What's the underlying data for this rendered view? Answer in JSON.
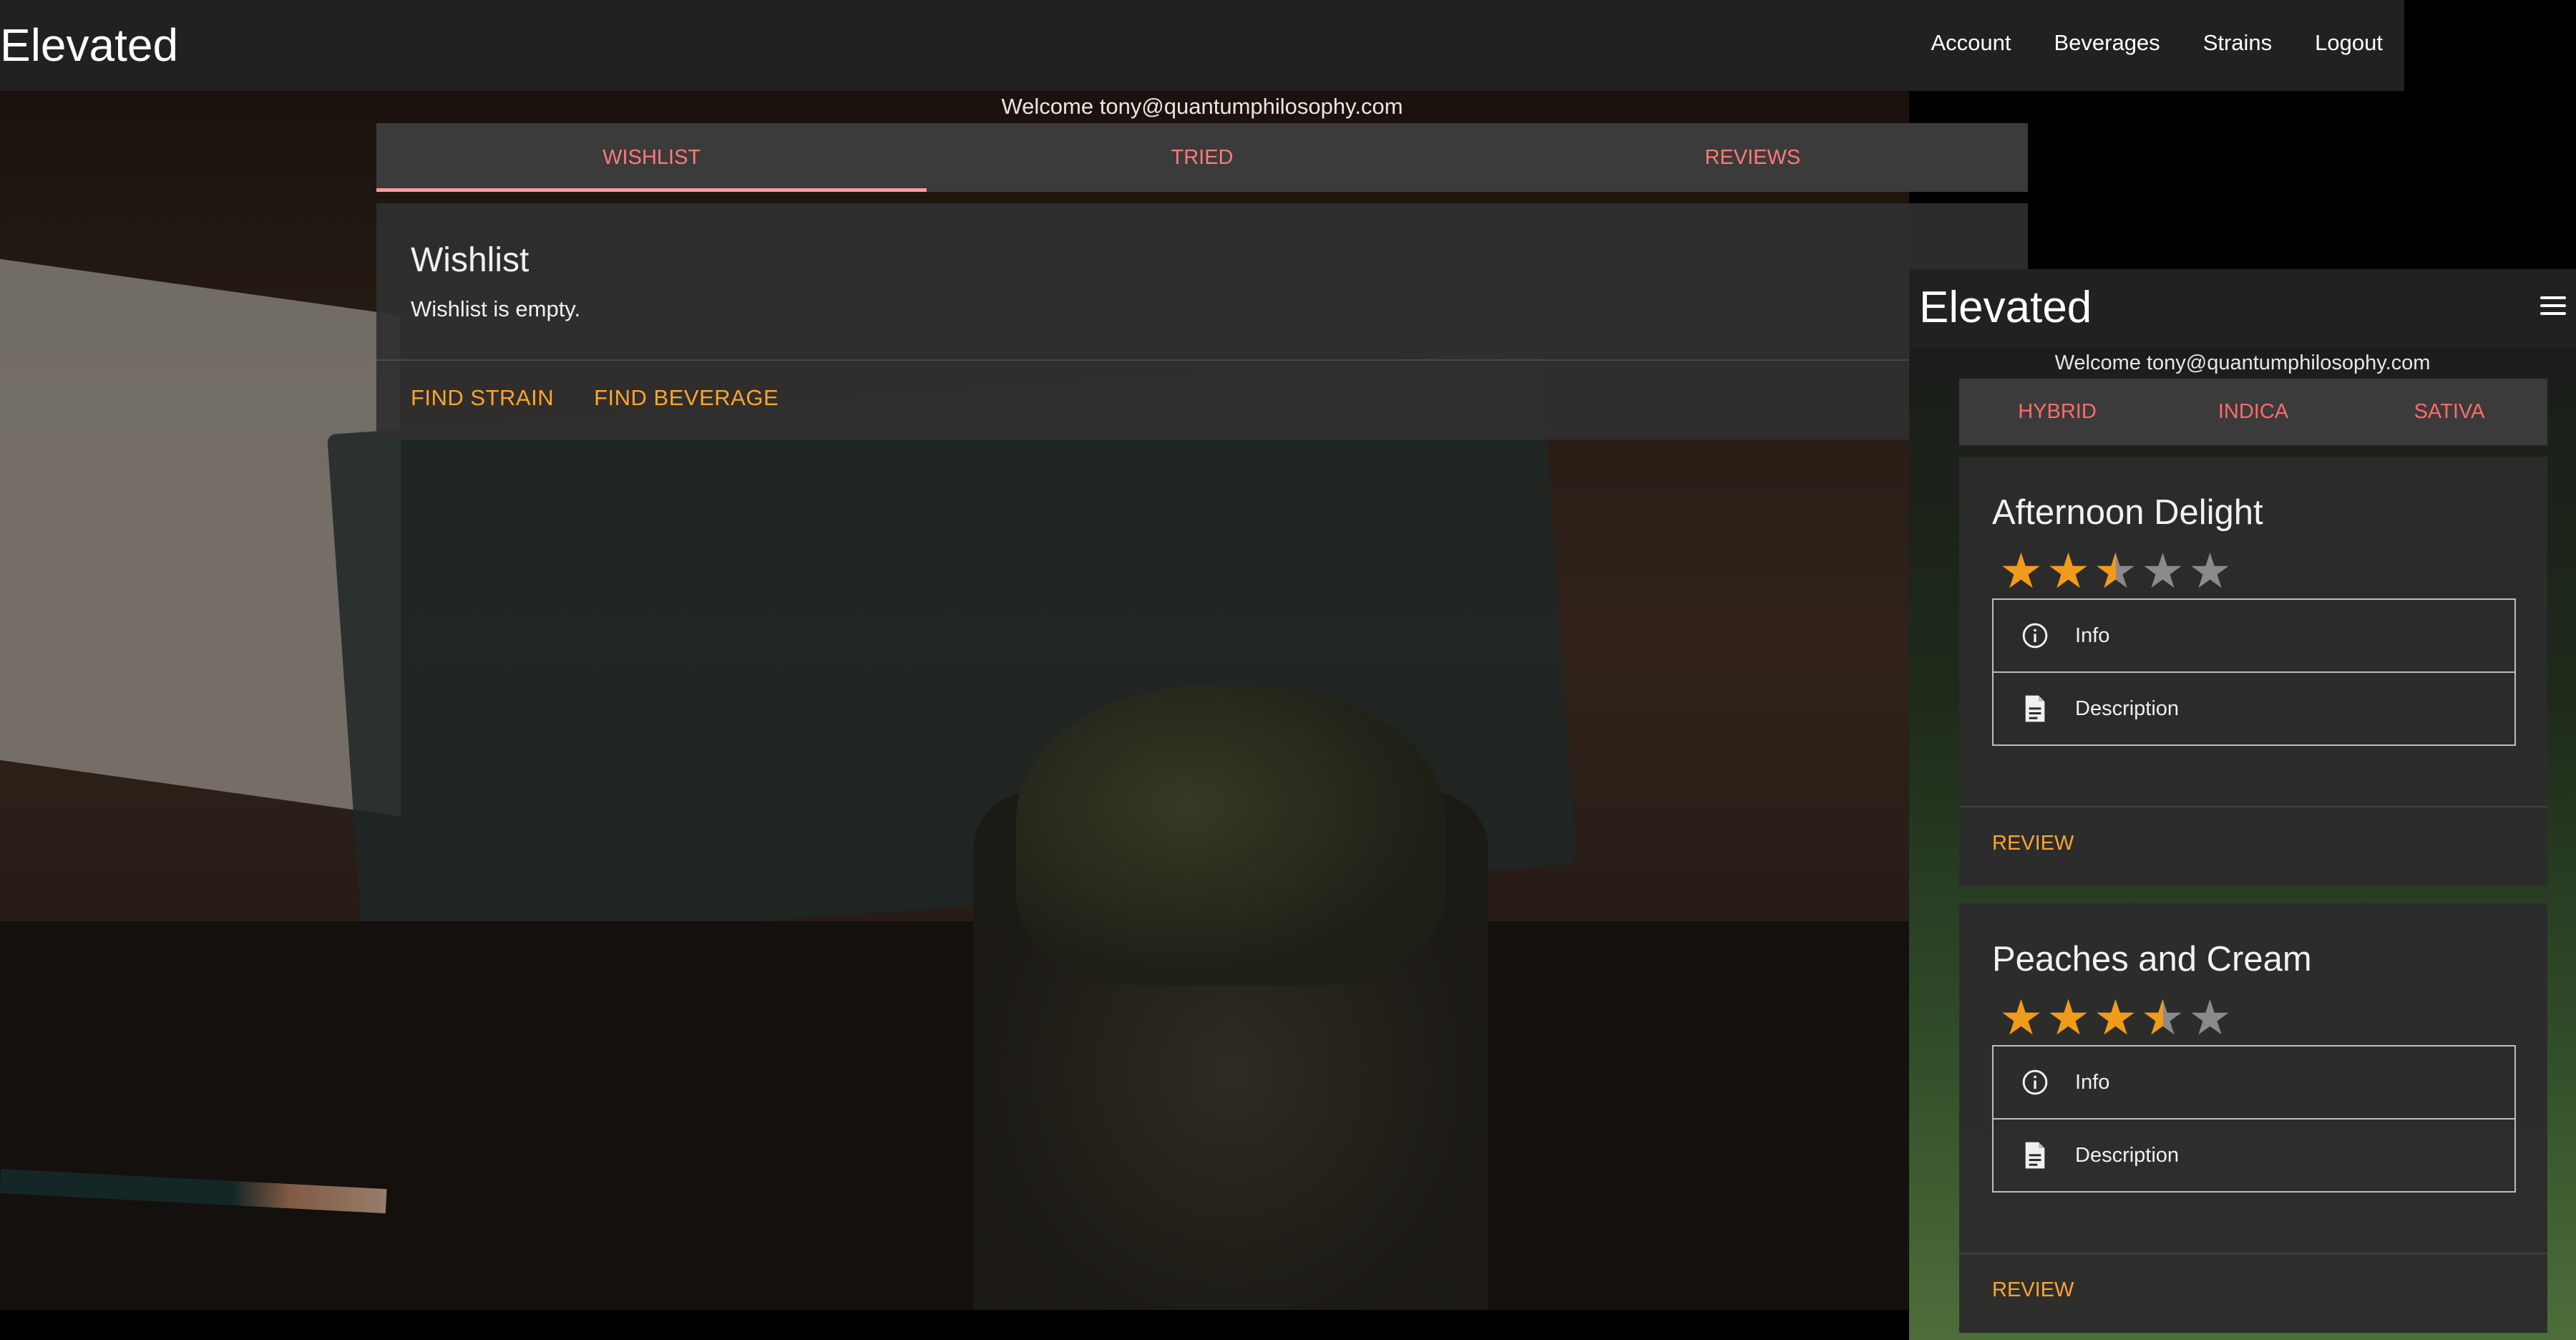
{
  "desktop": {
    "brand": "Elevated",
    "nav": [
      "Account",
      "Beverages",
      "Strains",
      "Logout"
    ],
    "welcome": "Welcome tony@quantumphilosophy.com",
    "tabs": [
      "WISHLIST",
      "TRIED",
      "REVIEWS"
    ],
    "active_tab": "WISHLIST",
    "card": {
      "title": "Wishlist",
      "text": "Wishlist is empty.",
      "actions": [
        "FIND STRAIN",
        "FIND BEVERAGE"
      ]
    }
  },
  "mobile": {
    "brand": "Elevated",
    "menu_icon": "hamburger-menu-icon",
    "welcome": "Welcome tony@quantumphilosophy.com",
    "tabs": [
      "HYBRID",
      "INDICA",
      "SATIVA"
    ],
    "strains": [
      {
        "name": "Afternoon Delight",
        "rating": 2.5,
        "items": [
          "Info",
          "Description"
        ],
        "action": "REVIEW"
      },
      {
        "name": "Peaches and Cream",
        "rating": 3.5,
        "items": [
          "Info",
          "Description"
        ],
        "action": "REVIEW"
      }
    ]
  },
  "colors": {
    "accent_orange": "#ffa42e",
    "tab_pink": "#ff7a7a",
    "star_gold": "#f29b1a",
    "bar_dark": "#212121"
  },
  "icons": {
    "info": "info-circle-icon",
    "description": "document-icon",
    "star": "star-icon"
  }
}
